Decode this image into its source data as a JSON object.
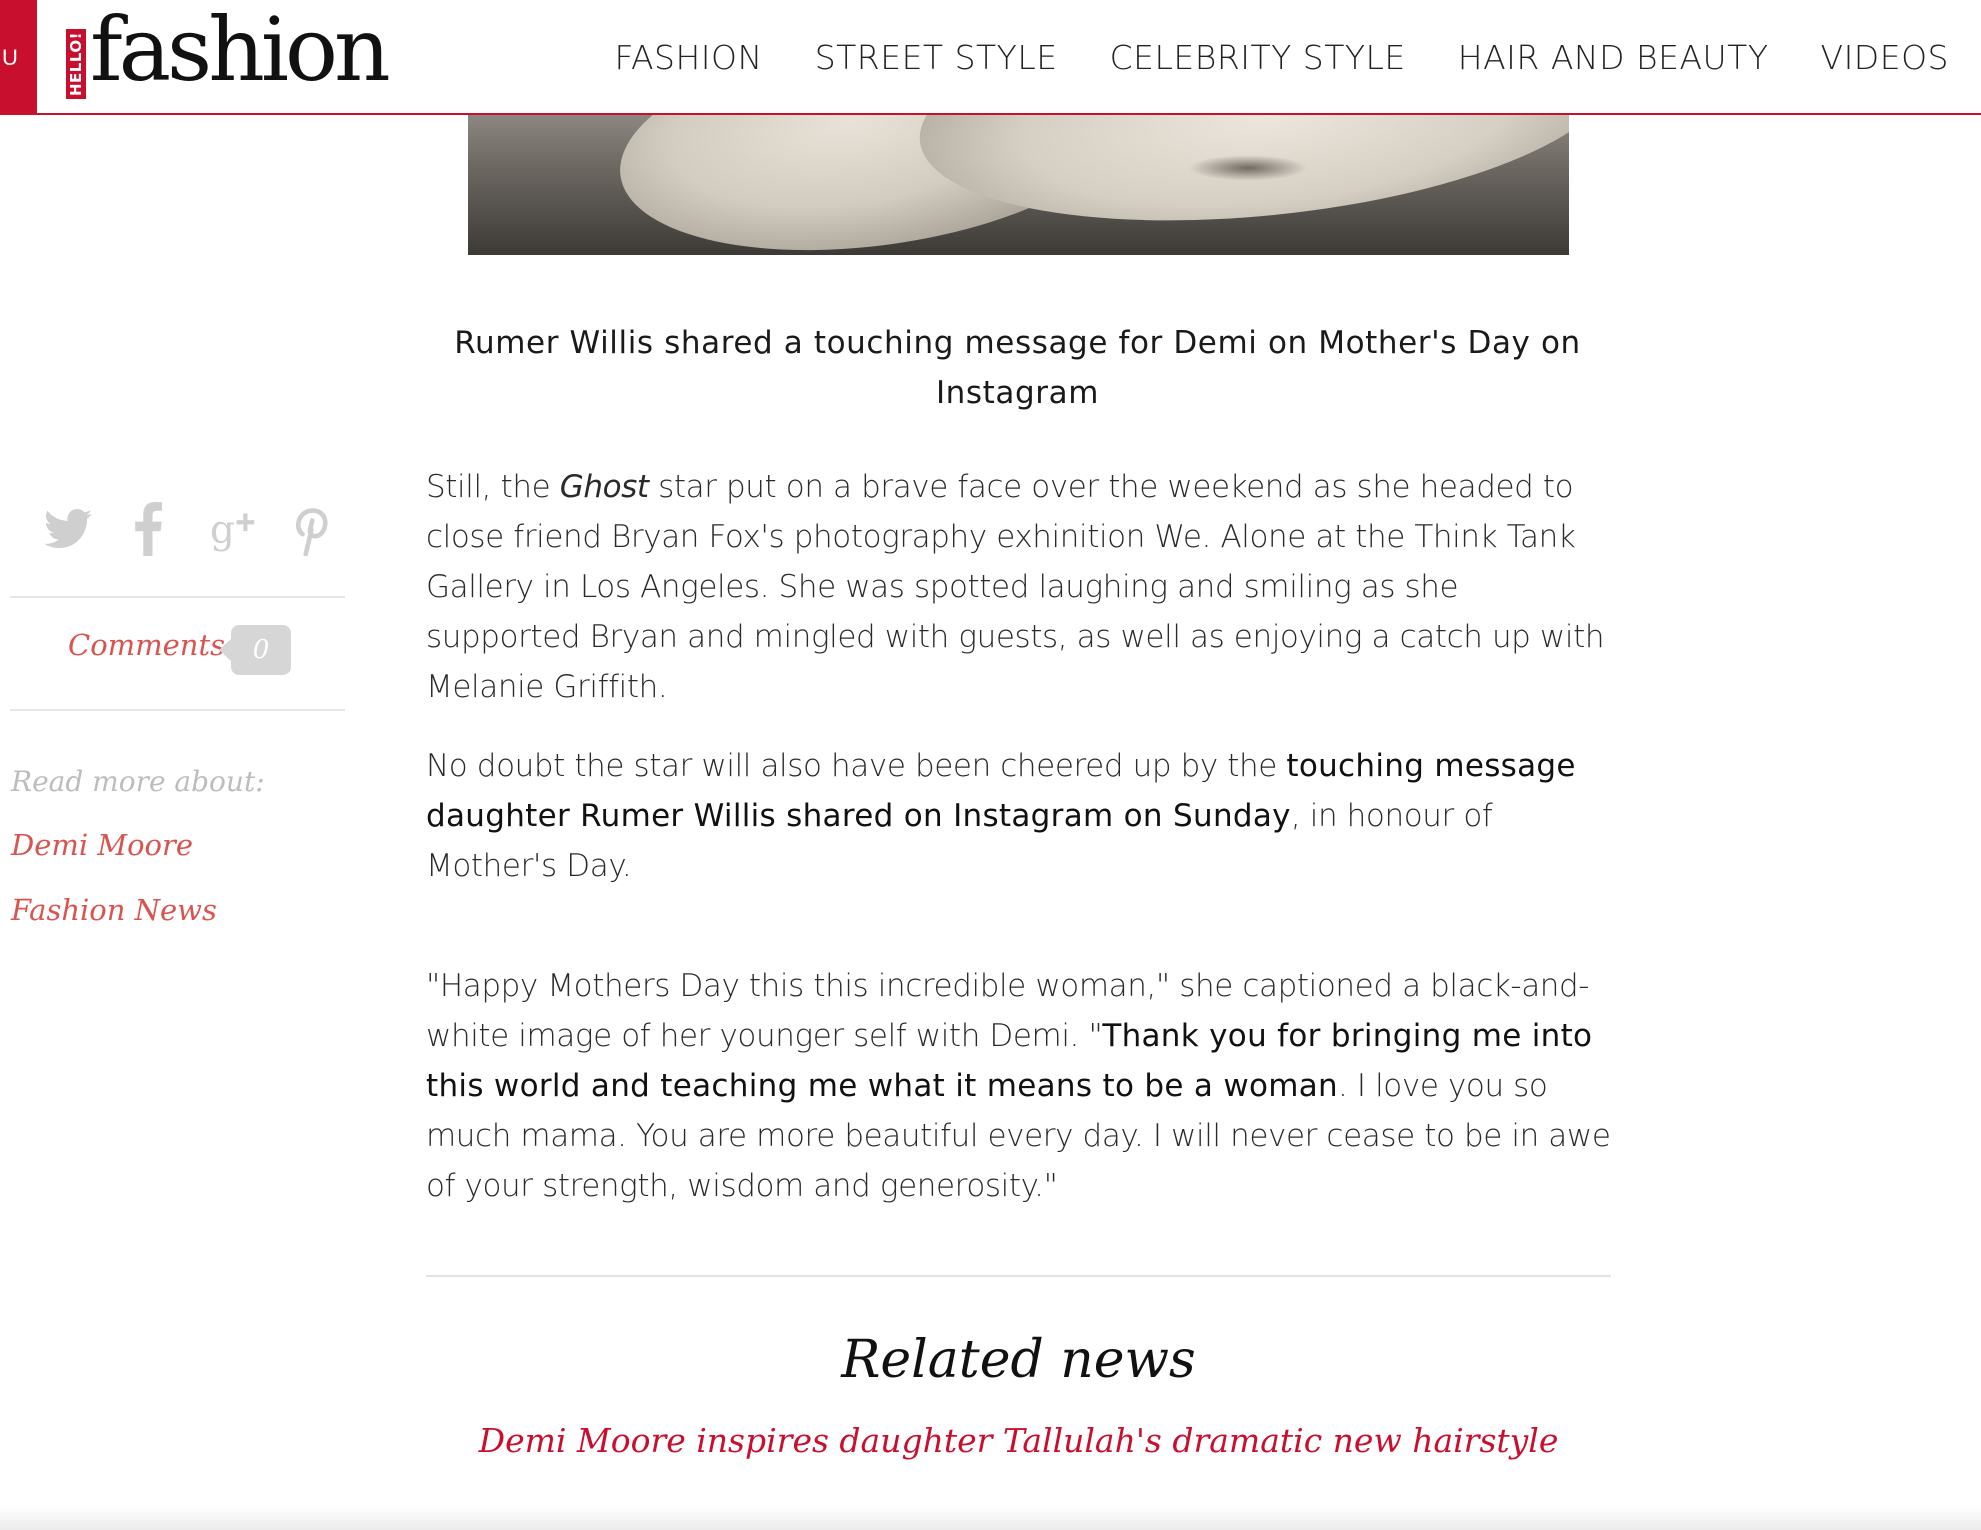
{
  "header": {
    "menu_tab_label": "U",
    "logo_hello": "HELLO!",
    "logo_word": "fashion",
    "nav": [
      "FASHION",
      "STREET STYLE",
      "CELEBRITY STYLE",
      "HAIR AND BEAUTY",
      "VIDEOS"
    ]
  },
  "caption": "Rumer Willis shared a touching message for Demi on Mother's Day on Instagram",
  "sidebar": {
    "share_icons": [
      "twitter-icon",
      "facebook-icon",
      "google-plus-icon",
      "pinterest-icon"
    ],
    "comments_label": "Comments",
    "comments_count": "0",
    "read_more_label": "Read more about:",
    "tags": [
      "Demi Moore",
      "Fashion News"
    ]
  },
  "article": {
    "p1": {
      "pre": "Still, the ",
      "em": "Ghost",
      "post": " star put on a brave face over the weekend as she headed to close friend Bryan Fox's photography exhinition We. Alone at the Think Tank Gallery in Los Angeles. She was spotted laughing and smiling as she supported Bryan and mingled with guests, as well as enjoying a catch up with Melanie Griffith."
    },
    "p2": {
      "pre": "No doubt the star will also have been cheered up by the ",
      "link": "touching message daughter Rumer Willis shared on Instagram on Sunday",
      "post": ", in honour of Mother's Day."
    },
    "p3": {
      "pre": "\"Happy Mothers Day this this incredible woman,\" she captioned a black-and-white image of her younger self with Demi. \"",
      "link": "Thank you for bringing me into this world and teaching me what it means to be a woman",
      "post": ". I love you so much mama. You are more beautiful every day. I will never cease to be in awe of your strength, wisdom and generosity.\""
    }
  },
  "related": {
    "title": "Related news",
    "items": [
      "Demi Moore inspires daughter Tallulah's dramatic new hairstyle"
    ]
  },
  "colors": {
    "brand_red": "#c8102e",
    "link_pink": "#d9534f",
    "muted_grey": "#bdbdbd",
    "icon_grey": "#cfcfcf"
  }
}
